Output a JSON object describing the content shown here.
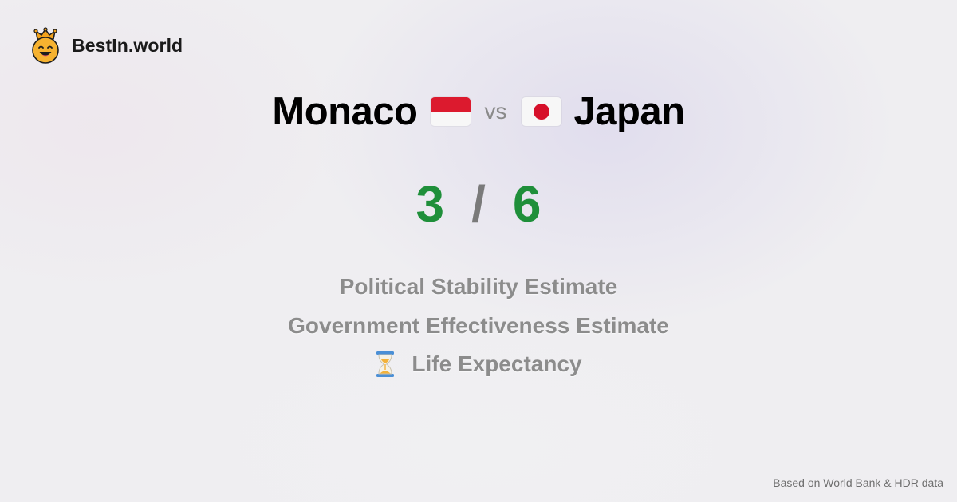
{
  "brand": {
    "name": "BestIn.world",
    "logo_icon": "crowned-smiley-icon"
  },
  "comparison": {
    "country_a": {
      "name": "Monaco",
      "flag_icon": "monaco-flag-icon"
    },
    "vs_label": "vs",
    "country_b": {
      "name": "Japan",
      "flag_icon": "japan-flag-icon"
    }
  },
  "score": {
    "a": "3",
    "separator": "/",
    "b": "6",
    "color": "#1f8f3a"
  },
  "metrics": [
    {
      "label": "Political Stability Estimate"
    },
    {
      "label": "Government Effectiveness Estimate"
    },
    {
      "label": "Life Expectancy",
      "icon": "hourglass-icon"
    }
  ],
  "footer": {
    "source": "Based on World Bank & HDR data"
  },
  "colors": {
    "score_green": "#1f8f3a",
    "metric_gray": "#8c8c8c",
    "monaco_red": "#dc1a2e",
    "japan_red": "#d6102a"
  }
}
